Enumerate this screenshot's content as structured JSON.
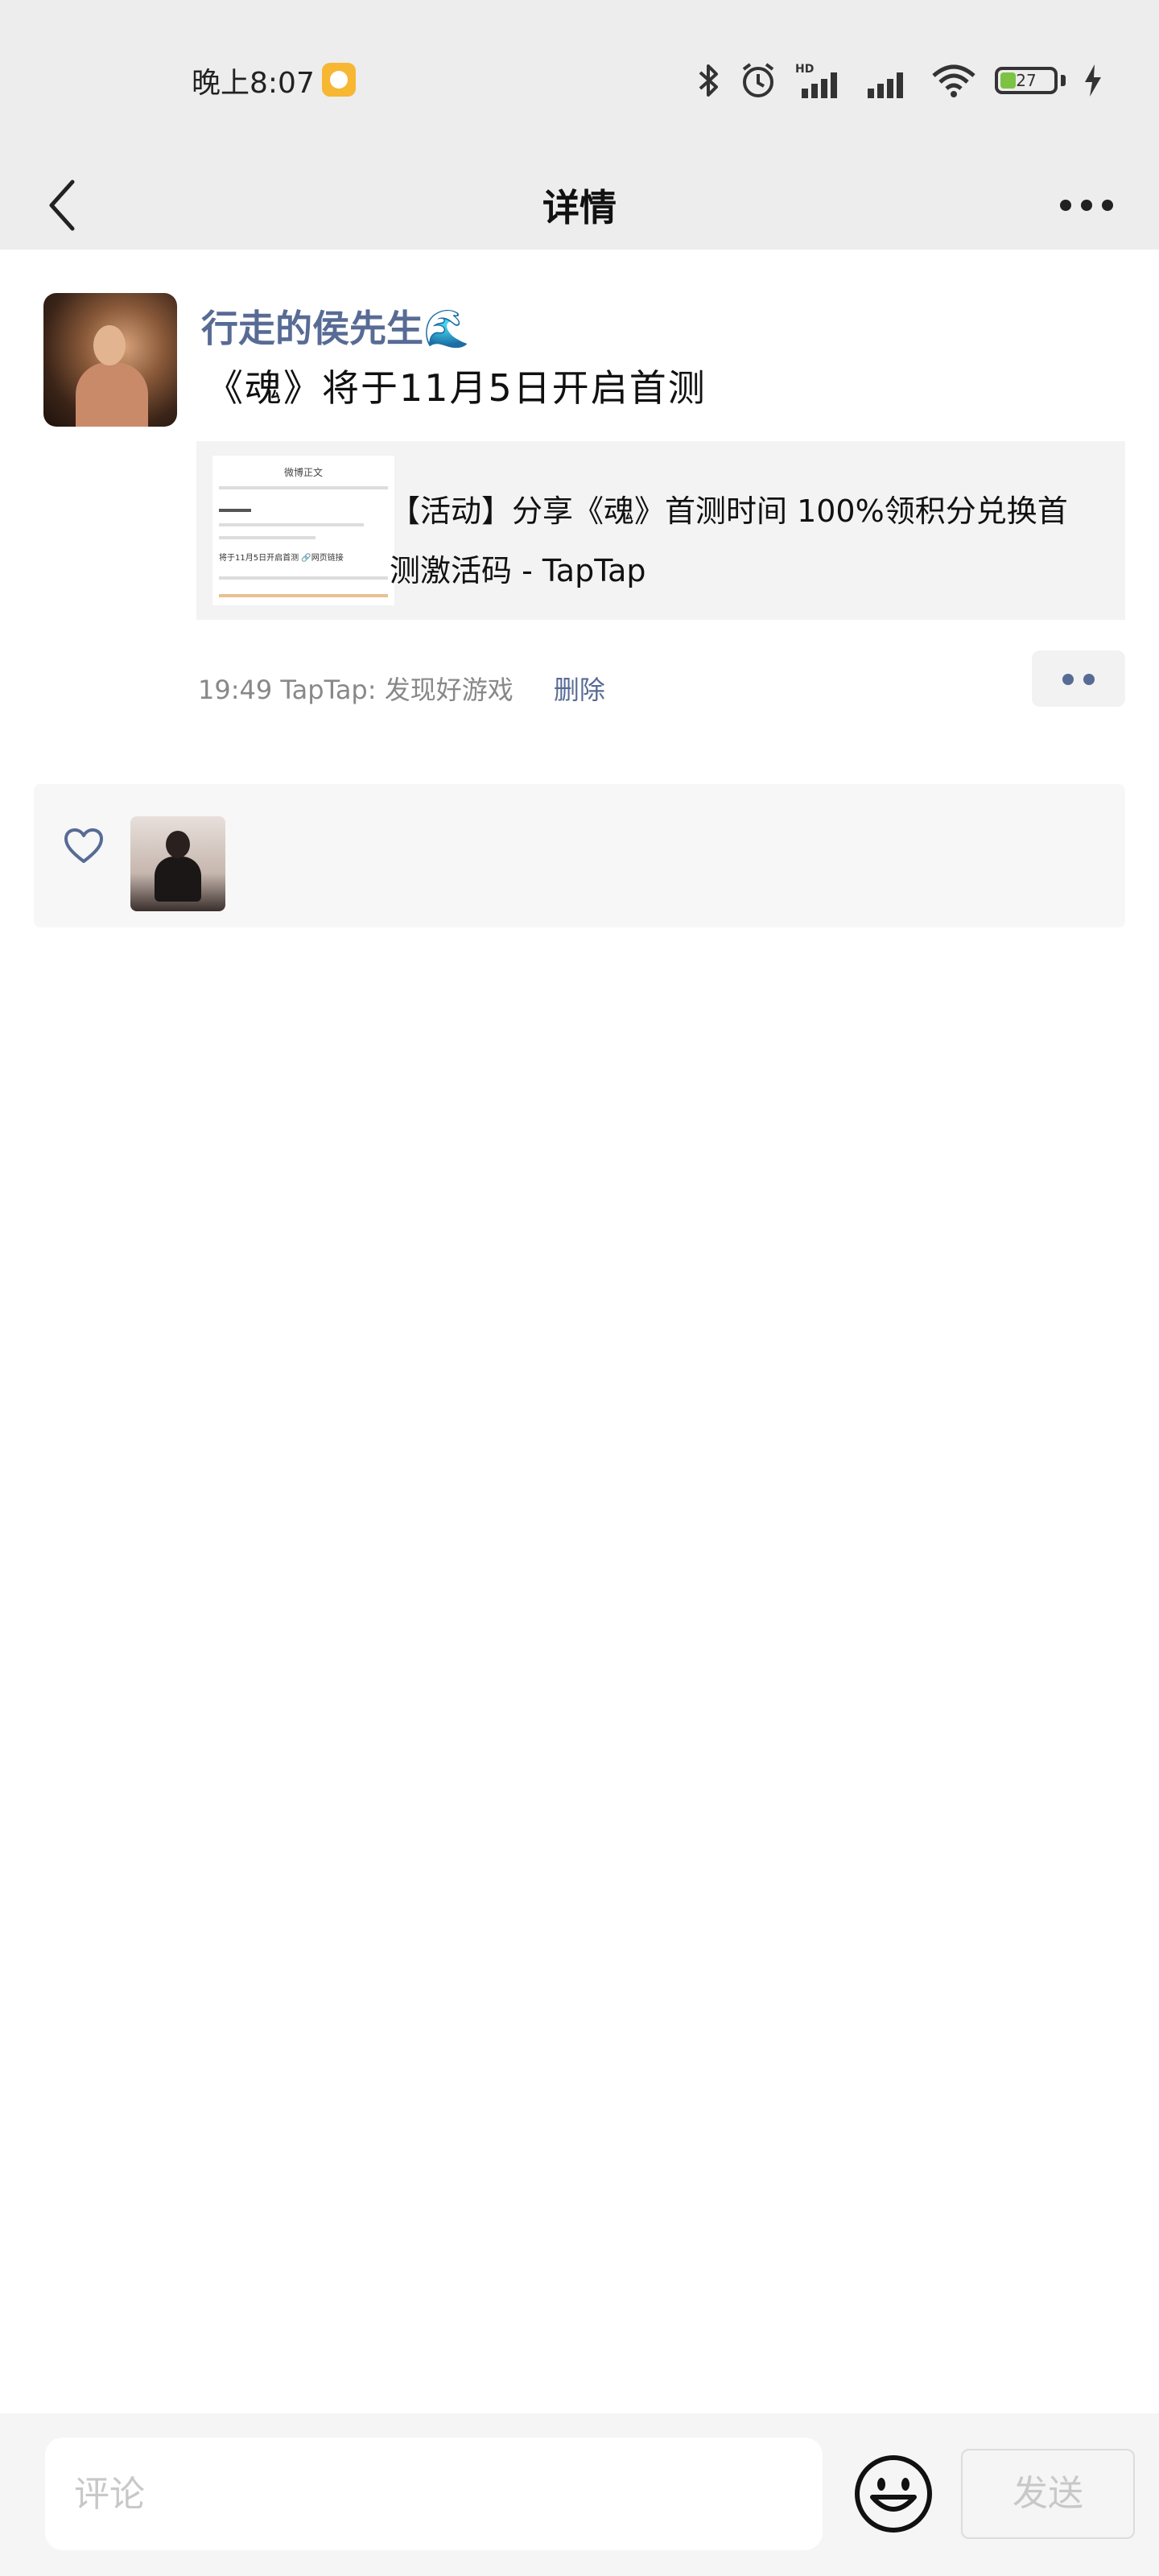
{
  "status_bar": {
    "time": "晚上8:07",
    "battery": "27",
    "icons": [
      "bluetooth-icon",
      "alarm-icon",
      "hd-signal-icon",
      "signal-icon",
      "wifi-icon",
      "battery-icon",
      "charging-icon"
    ]
  },
  "nav": {
    "title": "详情",
    "back_icon": "chevron-left-icon",
    "more_icon": "more-dots-icon"
  },
  "post": {
    "username": "行走的侯先生🌊",
    "text": "《魂》将于11月5日开启首测",
    "link": {
      "title": "【活动】分享《魂》首测时间 100%领积分兑换首测激活码 - TapTap",
      "thumb_title": "微博正文",
      "thumb_text": "将于11月5日开启首测 🔗网页链接"
    },
    "time": "19:49",
    "source": "TapTap: 发现好游戏",
    "delete_label": "删除"
  },
  "likes": {
    "icon": "heart-icon"
  },
  "bottom": {
    "comment_placeholder": "评论",
    "send_label": "发送",
    "emoji_icon": "emoji-icon"
  },
  "colors": {
    "link_blue": "#576b95",
    "header_bg": "#ededed",
    "battery_green": "#7dc243"
  }
}
